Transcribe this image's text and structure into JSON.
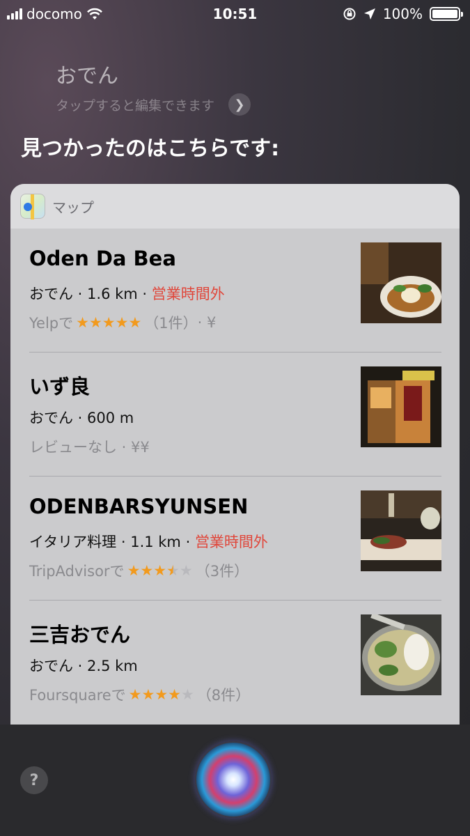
{
  "status_bar": {
    "carrier": "docomo",
    "time": "10:51",
    "battery": "100%",
    "battery_level": 1.0
  },
  "query": "おでん",
  "hint": "タップすると編集できます",
  "heading": "見つかったのはこちらです:",
  "card": {
    "app_name": "マップ",
    "items": [
      {
        "name": "Oden Da Bea",
        "category": "おでん",
        "distance": "1.6 km",
        "status": "営業時間外",
        "review_source": "Yelpで",
        "rating": 5,
        "rating_text": "（1件）",
        "price": " · ¥"
      },
      {
        "name": "いず良",
        "category": "おでん",
        "distance": "600 m",
        "status": "",
        "review_text": "レビューなし · ¥¥"
      },
      {
        "name": "ODENBARSYUNSEN",
        "category": "イタリア料理",
        "distance": "1.1 km",
        "status": "営業時間外",
        "review_source": "TripAdvisorで",
        "rating": 3.5,
        "rating_text": "（3件）"
      },
      {
        "name": "三吉おでん",
        "category": "おでん",
        "distance": "2.5 km",
        "status": "",
        "review_source": "Foursquareで",
        "rating": 4,
        "rating_text": "（8件）"
      }
    ]
  },
  "help_label": "?",
  "colors": {
    "closed": "#e0463a",
    "star": "#f29a1d",
    "card_bg": "#cbcbcd"
  }
}
